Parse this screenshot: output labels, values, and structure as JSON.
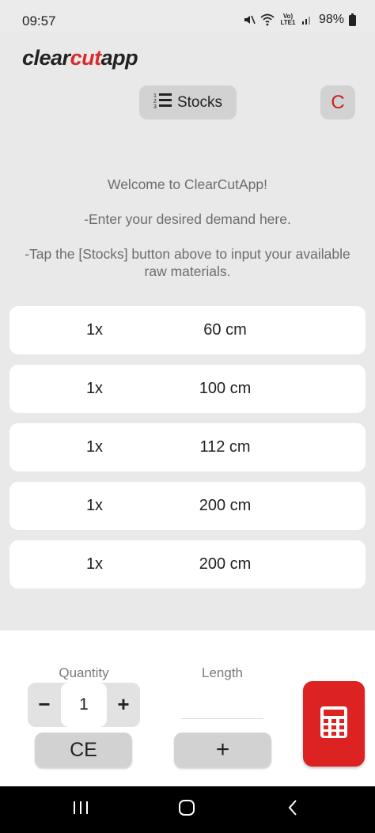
{
  "status_bar": {
    "time": "09:57",
    "battery": "98%",
    "network_label": "Vo) LTE1"
  },
  "header": {
    "logo_part1": "clear",
    "logo_part2": "cut",
    "logo_part3": "app",
    "stocks_label": "Stocks",
    "clear_label": "C"
  },
  "welcome": {
    "line1": "Welcome to ClearCutApp!",
    "line2": "-Enter your desired demand here.",
    "line3": "-Tap the [Stocks] button above to input your available raw materials."
  },
  "demands": [
    {
      "qty": "1x",
      "length": "60 cm"
    },
    {
      "qty": "1x",
      "length": "100 cm"
    },
    {
      "qty": "1x",
      "length": "112 cm"
    },
    {
      "qty": "1x",
      "length": "200 cm"
    },
    {
      "qty": "1x",
      "length": "200 cm"
    }
  ],
  "input_panel": {
    "quantity_label": "Quantity",
    "length_label": "Length",
    "quantity_value": "1",
    "length_value": "",
    "minus_label": "−",
    "plus_label": "+",
    "ce_label": "CE",
    "add_label": "+"
  },
  "colors": {
    "accent_red": "#dd2222",
    "button_gray": "#d2d2d2",
    "background": "#e9e9e9"
  },
  "icons": {
    "stocks": "numbered-list-icon",
    "calculate": "calculator-icon",
    "nav_recents": "recents-icon",
    "nav_home": "home-icon",
    "nav_back": "back-icon"
  }
}
